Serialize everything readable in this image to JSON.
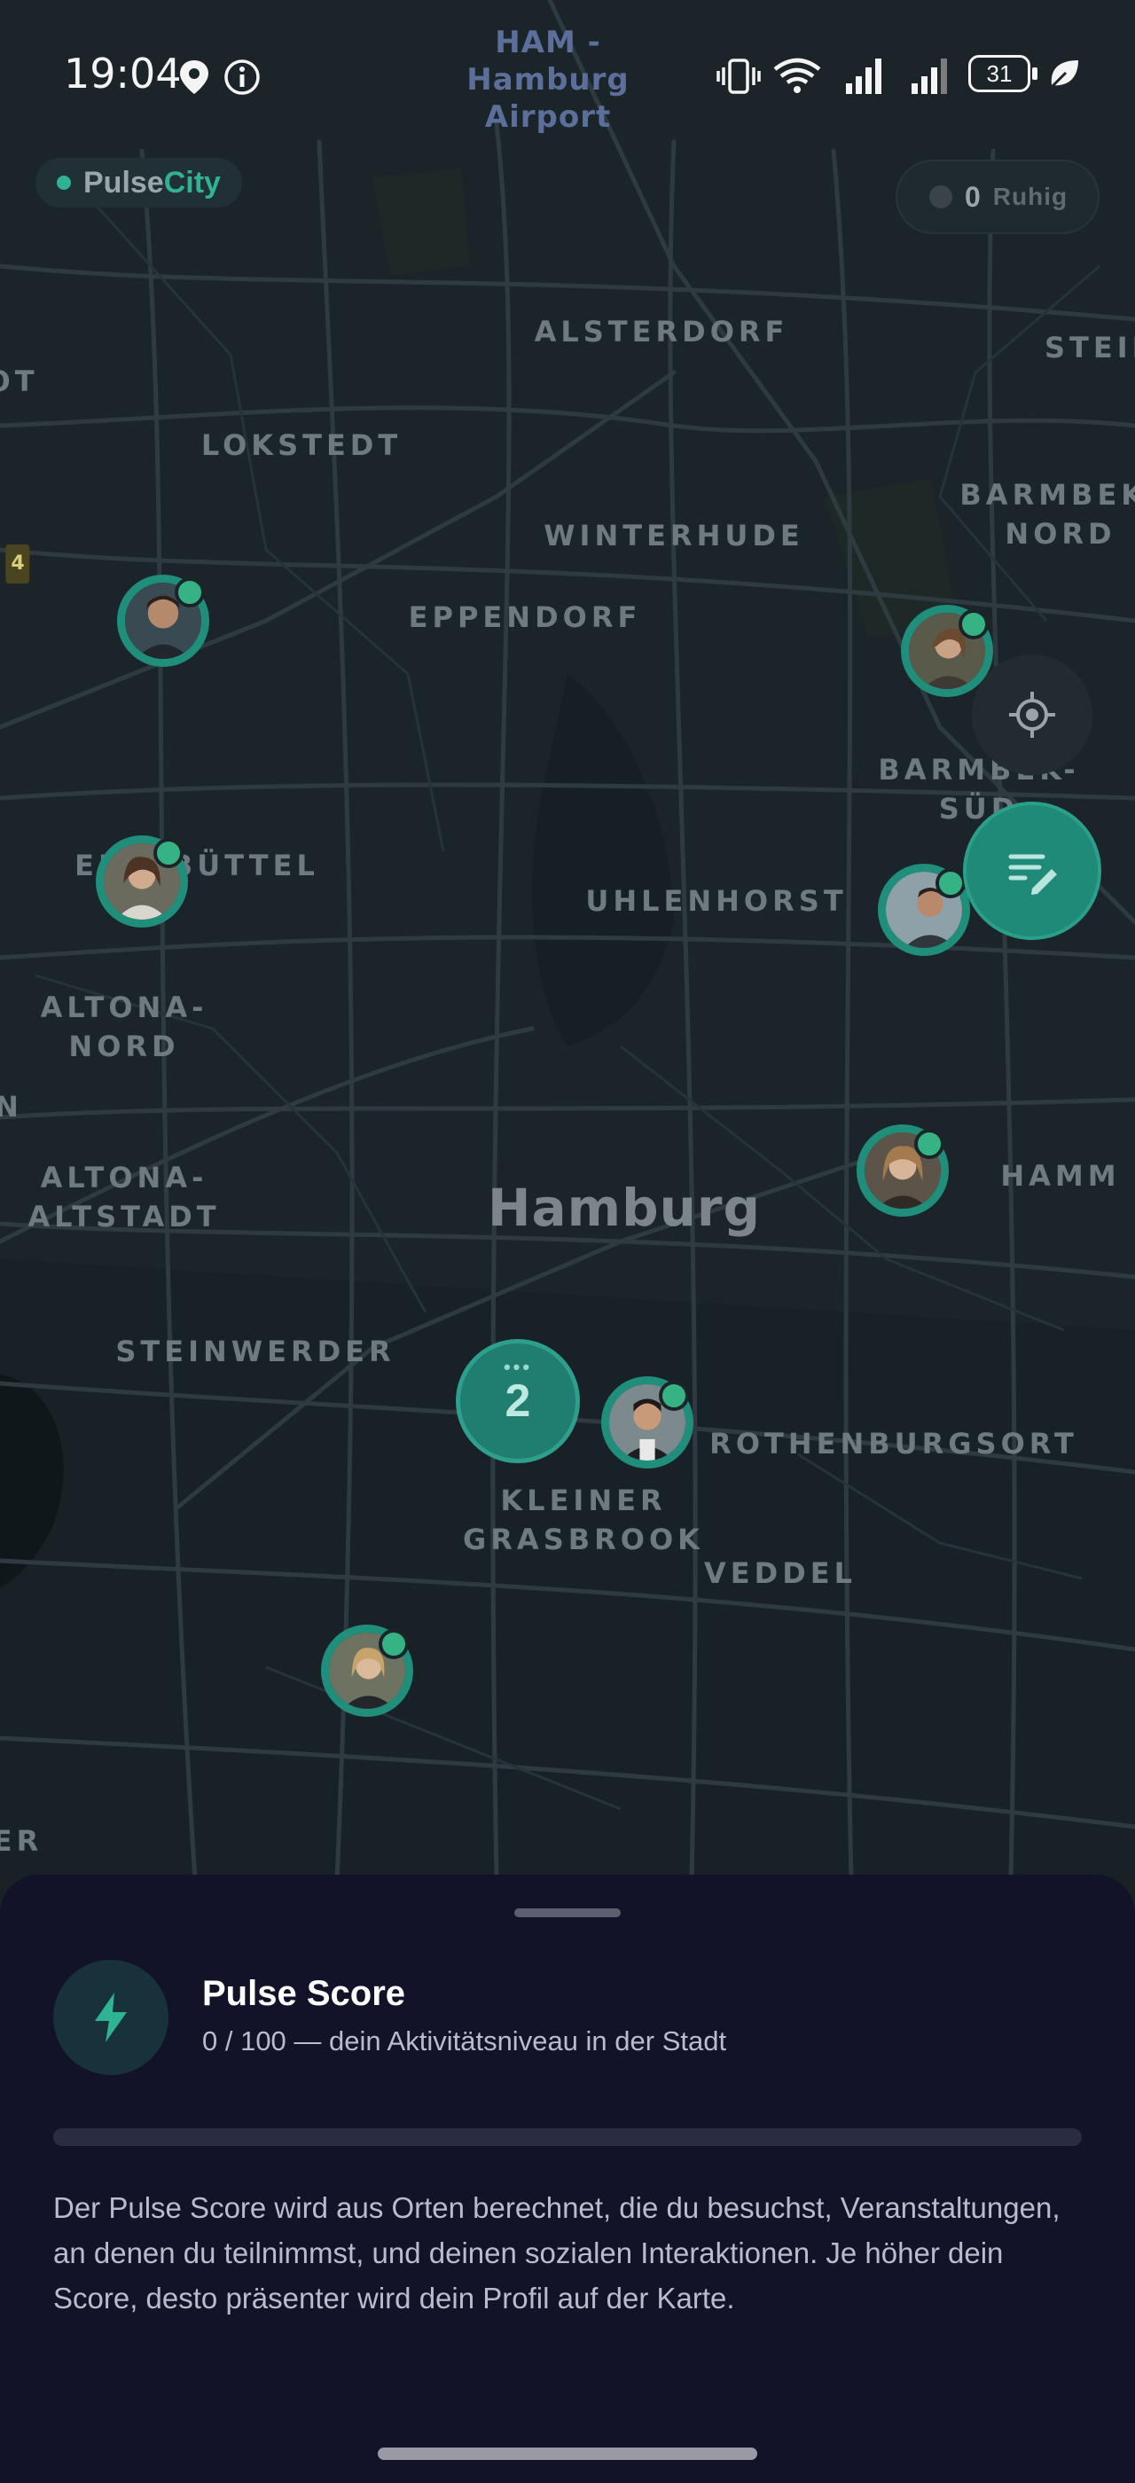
{
  "status_bar": {
    "time": "19:04",
    "battery": "31",
    "icons": [
      "location-pin-icon",
      "info-icon",
      "vibrate-icon",
      "wifi-icon",
      "signal-icon",
      "signal-icon-2",
      "battery-icon",
      "leaf-icon"
    ]
  },
  "brand": {
    "part1": "Pulse",
    "part2": "City"
  },
  "activity_chip": {
    "count": "0",
    "label": "Ruhig"
  },
  "map": {
    "labels": {
      "airport": "HAM -\nHamburg\nAirport",
      "alsterdorf": "ALSTERDORF",
      "steil": "STEIL",
      "ot": "OT",
      "lokstedt": "LOKSTEDT",
      "barmbek_nord": "BARMBEK-\nNORD",
      "winterhude": "WINTERHUDE",
      "eppendorf": "EPPENDORF",
      "road_4": "4",
      "barmbek_sued": "BARMBEK-\nSÜD",
      "eimsbuettel": "EIMSBÜTTEL",
      "uhlenhorst": "UHLENHORST",
      "altona_nord": "ALTONA-\nNORD",
      "n": "N",
      "altona_altstadt": "ALTONA-\nALTSTADT",
      "hamburg": "Hamburg",
      "hamm": "HAMM",
      "steinwerder": "STEINWERDER",
      "rothenburgsort": "ROTHENBURGSORT",
      "kleiner_grasbrook": "KLEINER\nGRASBROOK",
      "veddel": "VEDDEL",
      "er": "ER"
    },
    "cluster_count": "2",
    "user_markers": 8
  },
  "sheet": {
    "title": "Pulse Score",
    "subtitle": "0 / 100 — dein Aktivitätsniveau in der Stadt",
    "score": 0,
    "score_max": 100,
    "description": "Der Pulse Score wird aus Orten berechnet, die du besuchst, Veranstaltungen, an denen du teilnimmst, und deinen sozialen Interaktionen. Je höher dein Score, desto präsenter wird dein Profil auf der Karte."
  },
  "colors": {
    "accent": "#2fb394",
    "sheet_bg": "#121228",
    "map_bg": "#1b2428"
  }
}
